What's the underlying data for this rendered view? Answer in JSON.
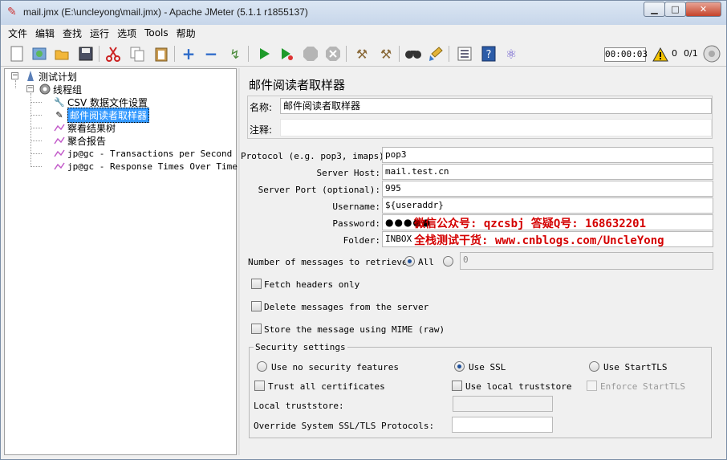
{
  "window": {
    "title": "mail.jmx (E:\\uncleyong\\mail.jmx) - Apache JMeter (5.1.1 r1855137)",
    "minimize_glyph": "▁",
    "maximize_glyph": "□",
    "close_glyph": "✕"
  },
  "menu": [
    "文件",
    "编辑",
    "查找",
    "运行",
    "选项",
    "Tools",
    "帮助"
  ],
  "toolbar": {
    "icons": [
      "new-icon",
      "templates-icon",
      "open-icon",
      "save-icon",
      "cut-icon",
      "copy-icon",
      "paste-icon",
      "expand-icon",
      "collapse-icon",
      "toggle-icon",
      "start-icon",
      "start-no-pause-icon",
      "stop-icon",
      "shutdown-icon",
      "clear-icon",
      "clear-all-icon",
      "search-icon",
      "reset-search-icon",
      "function-helper-icon",
      "help-icon",
      "remote-icon"
    ],
    "timer": "00:00:03",
    "warning_count": "0",
    "threads": "0/1"
  },
  "tree": {
    "test_plan": "测试计划",
    "thread_group": "线程组",
    "items": [
      "CSV 数据文件设置",
      "邮件阅读者取样器",
      "察看结果树",
      "聚合报告",
      "jp@gc - Transactions per Second",
      "jp@gc - Response Times Over Time"
    ]
  },
  "panel": {
    "title": "邮件阅读者取样器",
    "name_label": "名称:",
    "name_value": "邮件阅读者取样器",
    "comment_label": "注释:",
    "comment_value": "",
    "protocol_label": "Protocol (e.g. pop3, imaps):",
    "protocol_value": "pop3",
    "server_host_label": "Server Host:",
    "server_host_value": "mail.test.cn",
    "server_port_label": "Server Port (optional):",
    "server_port_value": "995",
    "username_label": "Username:",
    "username_value": "${useraddr}",
    "password_label": "Password:",
    "password_value": "●●●●●",
    "folder_label": "Folder:",
    "folder_value": "INBOX",
    "num_messages_label": "Number of messages to retrieve:",
    "num_all_label": "All",
    "num_count_value": "0",
    "fetch_headers_label": "Fetch headers only",
    "delete_messages_label": "Delete messages from the server",
    "store_mime_label": "Store the message using MIME (raw)",
    "security": {
      "legend": "Security settings",
      "no_security_label": "Use no security features",
      "use_ssl_label": "Use SSL",
      "use_starttls_label": "Use StartTLS",
      "trust_all_label": "Trust all certificates",
      "use_local_truststore_label": "Use local truststore",
      "enforce_starttls_label": "Enforce StartTLS",
      "local_truststore_label": "Local truststore:",
      "local_truststore_value": "",
      "override_protocols_label": "Override System SSL/TLS Protocols:",
      "override_protocols_value": ""
    }
  },
  "watermark": {
    "line1": "微信公众号: qzcsbj   答疑Q号: 168632201",
    "line2": "全栈测试干货: www.cnblogs.com/UncleYong"
  }
}
